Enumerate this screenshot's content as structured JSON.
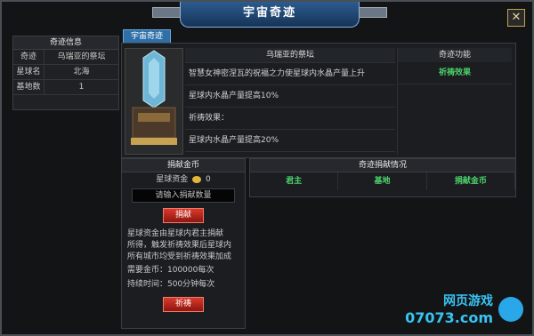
{
  "title": "宇宙奇迹",
  "close_symbol": "✕",
  "left_panel": {
    "header": "奇迹信息",
    "rows": [
      {
        "key": "奇迹",
        "value": "乌瑞亚的祭坛"
      },
      {
        "key": "星球名",
        "value": "北海"
      },
      {
        "key": "基地数",
        "value": "1"
      }
    ]
  },
  "tab": "宇宙奇迹",
  "main": {
    "altar_title": "乌瑞亚的祭坛",
    "function_header": "奇迹功能",
    "line1": "智慧女神密涅瓦的祝福之力使星球内水晶产量上升",
    "line2": "星球内水晶产量提高10%",
    "line3": "祈祷效果：",
    "line4": "星球内水晶产量提高20%",
    "function_cell": "祈祷效果"
  },
  "donate": {
    "header": "捐献金币",
    "fund_label": "星球资金",
    "fund_value": "0",
    "input_placeholder": "请输入捐献数量",
    "donate_button": "捐献",
    "desc1": "星球资金由星球内君主捐献",
    "desc2": "所得，触发祈祷效果后星球内",
    "desc3": "所有城市均受到祈祷效果加成",
    "required_gold": "需要金币：100000每次",
    "duration": "持续时间：500分钟每次",
    "pray_button": "祈祷"
  },
  "status": {
    "header": "奇迹捐献情况",
    "columns": [
      "君主",
      "基地",
      "捐献金币"
    ]
  },
  "watermark": {
    "top": "网页游戏",
    "bottom": "07073.com"
  },
  "colors": {
    "accent": "#2f6fa8",
    "green_text": "#4cd36b",
    "red_button": "#c92a1e"
  }
}
